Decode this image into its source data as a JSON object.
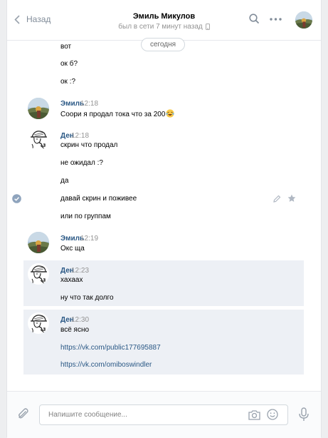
{
  "header": {
    "back_label": "Назад",
    "contact_name": "Эмиль Микулов",
    "status": "был в сети 7 минут назад"
  },
  "date_divider": "сегодня",
  "messages": {
    "m1": "вот",
    "m2": "ок б?",
    "m3": "ок :?",
    "g1_author": "Эмиль",
    "g1_time": "12:18",
    "m4": "Соори я продал тока что за 200",
    "g2_author": "Ден",
    "g2_time": "12:18",
    "m5": "скрин что продал",
    "m6": "не ожидал :?",
    "m7": "да",
    "m8": "давай скрин и поживее",
    "m9": "или по группам",
    "g3_author": "Эмиль",
    "g3_time": "12:19",
    "m10": "Окс ща",
    "g4_author": "Ден",
    "g4_time": "12:23",
    "m11": "хахаах",
    "m12": "ну что так долго",
    "g5_author": "Ден",
    "g5_time": "12:30",
    "m13": "всё ясно",
    "m14": "https://vk.com/public177695887",
    "m15": "https://vk.com/omiboswindler"
  },
  "composer": {
    "placeholder": "Напишите сообщение..."
  },
  "icons": {
    "back": "chevron-left-icon",
    "search": "search-icon",
    "more": "more-icon",
    "mobile": "phone-icon",
    "attach": "paperclip-icon",
    "camera": "camera-icon",
    "emoji": "smiley-icon",
    "voice": "microphone-icon",
    "emoji_in_text": "laughing-face",
    "edit": "pencil-icon",
    "favorite": "star-icon",
    "selected": "check-circle-icon"
  },
  "colors": {
    "link": "#2a5885",
    "muted": "#939393",
    "selected_bg": "#edf0f5",
    "page_bg": "#edeef0"
  }
}
